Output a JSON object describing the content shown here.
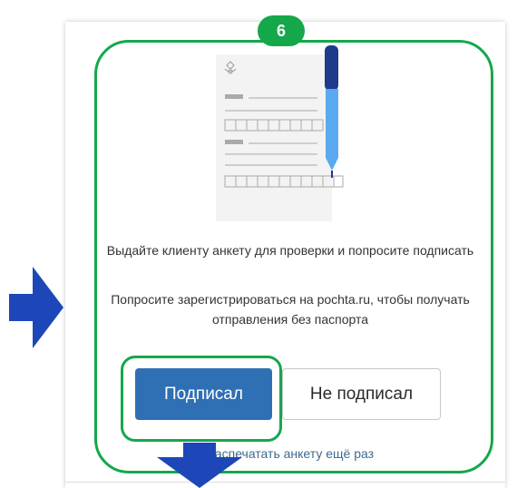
{
  "step": {
    "number": "6"
  },
  "form": {
    "instruction": "Выдайте клиенту анкету для проверки и попросите подписать",
    "hint": "Попросите зарегистрироваться на pochta.ru, чтобы получать отправления без паспорта"
  },
  "buttons": {
    "signed": "Подписал",
    "not_signed": "Не подписал"
  },
  "link": {
    "print_again": "Распечатать анкету ещё раз"
  },
  "colors": {
    "highlight_green": "#14a84b",
    "primary_button": "#2f6fb4",
    "arrow_blue": "#1d47b8",
    "pen_blue": "#5ba9f0",
    "pen_dark": "#1e3a8a"
  },
  "icons": {
    "illustration": "document-with-pen",
    "arrows": [
      "arrow-right-icon",
      "arrow-down-icon"
    ]
  }
}
